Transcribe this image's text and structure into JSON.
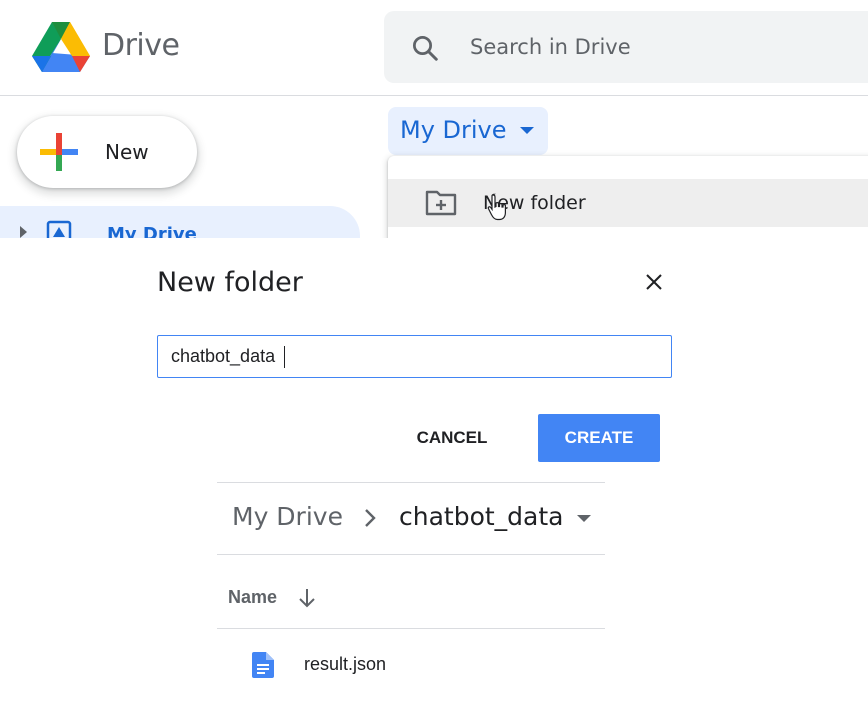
{
  "header": {
    "brand": "Drive",
    "search_placeholder": "Search in Drive",
    "search_icon": "search-icon"
  },
  "sidebar": {
    "new_label": "New",
    "items": [
      {
        "label": "My Drive",
        "icon": "my-drive-icon",
        "active": true
      }
    ]
  },
  "location_button": {
    "label": "My Drive"
  },
  "context_menu": {
    "items": [
      {
        "label": "New folder",
        "icon": "new-folder-icon",
        "hovered": true
      }
    ]
  },
  "dialog": {
    "title": "New folder",
    "input_value": "chatbot_data",
    "cancel_label": "CANCEL",
    "create_label": "CREATE"
  },
  "folder_view": {
    "breadcrumb": [
      "My Drive",
      "chatbot_data"
    ],
    "column_header": "Name",
    "sort": "descending",
    "files": [
      {
        "name": "result.json",
        "icon": "document-icon"
      }
    ]
  },
  "colors": {
    "accent": "#1967d2",
    "button": "#4285f4",
    "selected_bg": "#e8f0fe",
    "text": "#202124",
    "muted": "#5f6368"
  }
}
